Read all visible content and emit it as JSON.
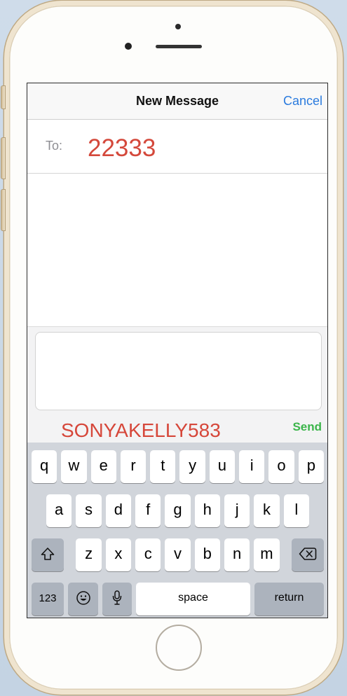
{
  "nav": {
    "title": "New Message",
    "cancel_label": "Cancel"
  },
  "recipient": {
    "label": "To:",
    "value": "22333"
  },
  "compose": {
    "message_annotation": "SONYAKELLY583",
    "send_label": "Send"
  },
  "keyboard": {
    "row1": [
      "q",
      "w",
      "e",
      "r",
      "t",
      "y",
      "u",
      "i",
      "o",
      "p"
    ],
    "row2": [
      "a",
      "s",
      "d",
      "f",
      "g",
      "h",
      "j",
      "k",
      "l"
    ],
    "row3": [
      "z",
      "x",
      "c",
      "v",
      "b",
      "n",
      "m"
    ],
    "numbers_label": "123",
    "space_label": "space",
    "return_label": "return",
    "icons": {
      "shift": "shift-icon",
      "backspace": "backspace-icon",
      "emoji": "emoji-icon",
      "dictation": "microphone-icon"
    }
  },
  "colors": {
    "accent_blue": "#2b7bde",
    "send_green": "#3bb54a",
    "annotation_red": "#d6473a",
    "recipient_red": "#d4483b",
    "keyboard_background": "#d1d5db",
    "function_key": "#acb3bd"
  }
}
